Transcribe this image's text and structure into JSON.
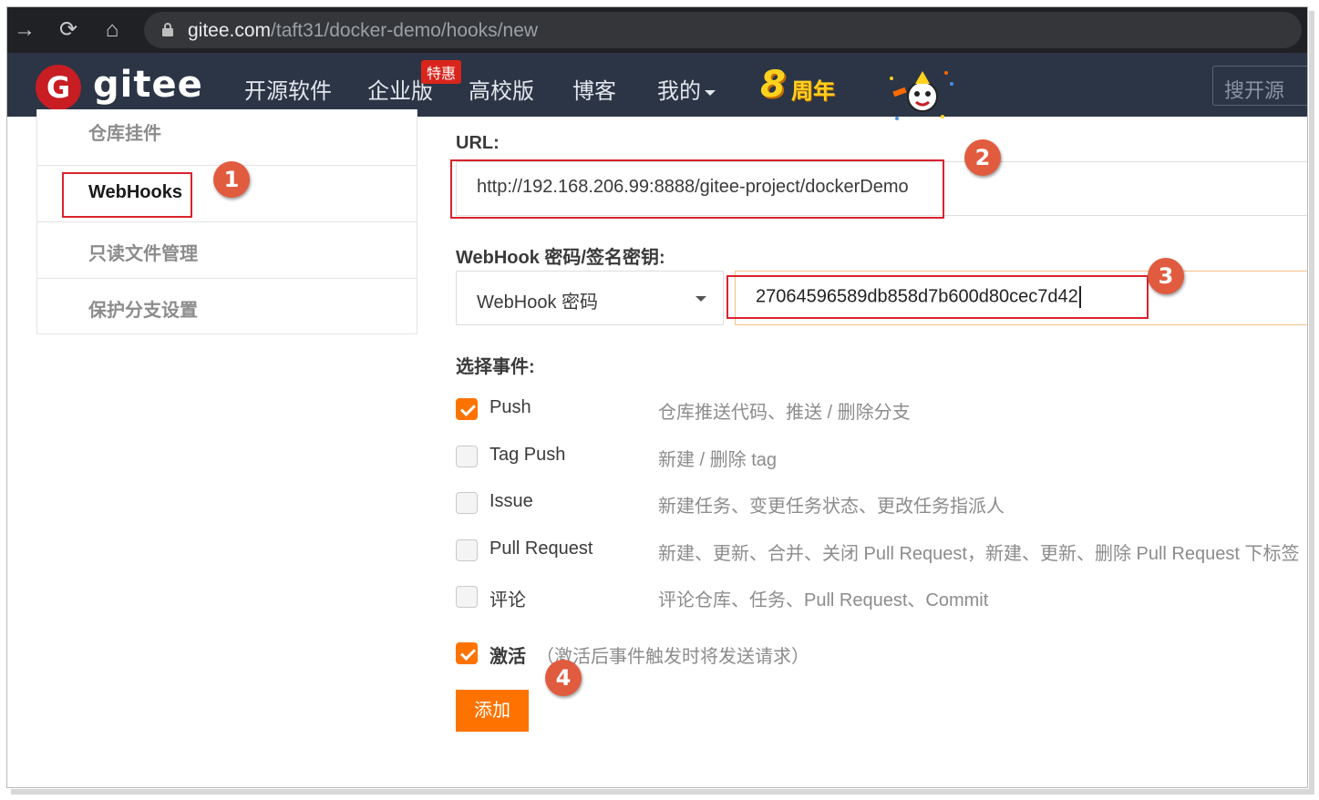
{
  "browser": {
    "url_host": "gitee.com",
    "url_path": "/taft31/docker-demo/hooks/new",
    "back_icon": "→",
    "reload_icon": "⟳",
    "home_icon": "⌂"
  },
  "header": {
    "logo_letter": "G",
    "logo_text": "gitee",
    "nav": [
      "开源软件",
      "企业版",
      "高校版",
      "博客",
      "我的"
    ],
    "promo_badge": "特惠",
    "anniversary_number": "8",
    "anniversary_text": "周年",
    "search_placeholder": "搜开源"
  },
  "sidebar": {
    "items": [
      {
        "label": "仓库挂件",
        "active": false
      },
      {
        "label": "WebHooks",
        "active": true
      },
      {
        "label": "只读文件管理",
        "active": false
      },
      {
        "label": "保护分支设置",
        "active": false
      }
    ]
  },
  "form": {
    "url_label": "URL:",
    "url_value": "http://192.168.206.99:8888/gitee-project/dockerDemo",
    "secret_label": "WebHook 密码/签名密钥:",
    "secret_type": "WebHook 密码",
    "secret_value": "27064596589db858d7b600d80cec7d42",
    "events_label": "选择事件:",
    "events": [
      {
        "name": "Push",
        "desc": "仓库推送代码、推送 / 删除分支",
        "checked": true
      },
      {
        "name": "Tag Push",
        "desc": "新建 / 删除 tag",
        "checked": false
      },
      {
        "name": "Issue",
        "desc": "新建任务、变更任务状态、更改任务指派人",
        "checked": false
      },
      {
        "name": "Pull Request",
        "desc": "新建、更新、合并、关闭 Pull Request，新建、更新、删除 Pull Request 下标签",
        "checked": false
      },
      {
        "name": "评论",
        "desc": "评论仓库、任务、Pull Request、Commit",
        "checked": false
      }
    ],
    "activate_label": "激活",
    "activate_hint": "（激活后事件触发时将发送请求）",
    "activate_checked": true,
    "submit_label": "添加"
  },
  "annotations": [
    "1",
    "2",
    "3",
    "4"
  ],
  "colors": {
    "accent": "#fe7300",
    "header_bg": "#2b3545",
    "logo_red": "#c71d23",
    "highlight_red": "#d9232d",
    "marker": "#e15b3f"
  }
}
